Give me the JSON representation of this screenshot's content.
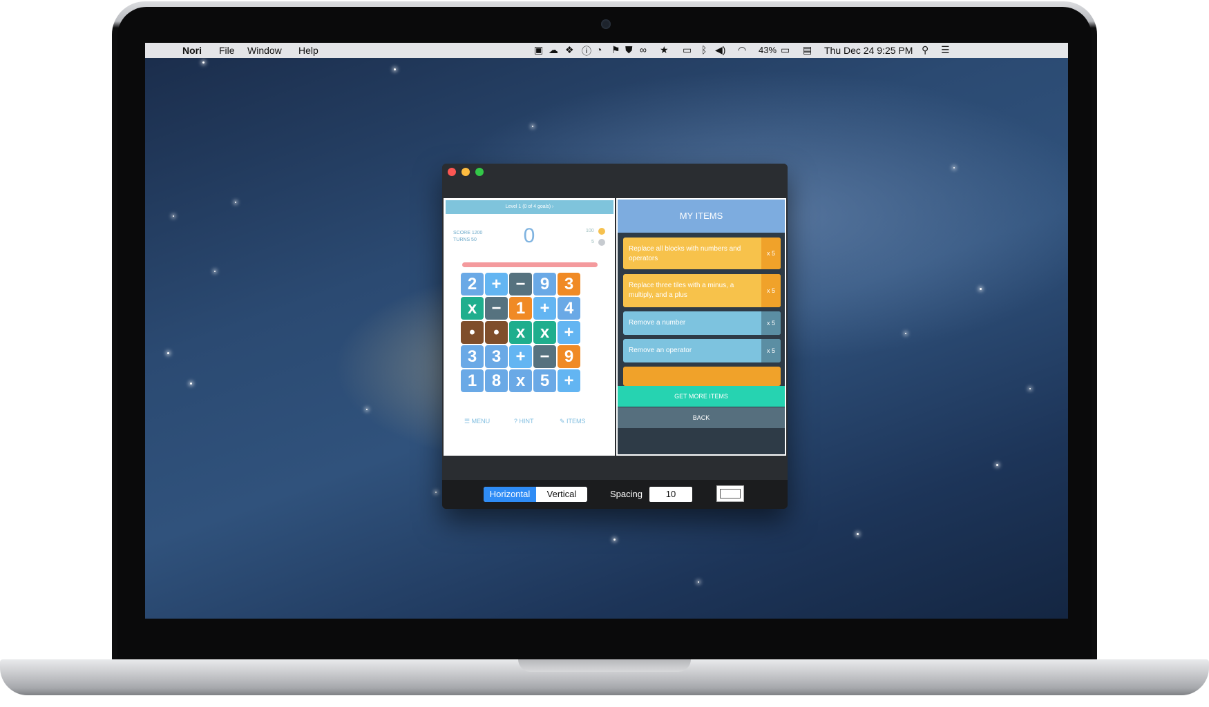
{
  "menubar": {
    "app_name": "Nori",
    "menus": [
      "File",
      "Window",
      "Help"
    ],
    "battery": "43%",
    "clock": "Thu Dec 24  9:25 PM"
  },
  "game": {
    "level_label": "Level 1 (0 of 4 goals) ›",
    "score_label": "SCORE 1200",
    "turns_label": "TURNS 50",
    "score_value": "0",
    "coins_a": "100",
    "coins_b": "5",
    "grid": [
      [
        "2",
        "+",
        "−",
        "9",
        "3"
      ],
      [
        "x",
        "−",
        "1",
        "+",
        "4"
      ],
      [
        "•",
        "•",
        "x",
        "x",
        "+"
      ],
      [
        "3",
        "3",
        "+",
        "−",
        "9"
      ],
      [
        "1",
        "8",
        "x",
        "5",
        "+"
      ]
    ],
    "grid_colors": [
      [
        "blue",
        "sky",
        "dark",
        "blue",
        "orange"
      ],
      [
        "green",
        "dark",
        "orange",
        "sky",
        "blue"
      ],
      [
        "brown",
        "brown",
        "green",
        "green",
        "sky"
      ],
      [
        "blue",
        "blue",
        "sky",
        "dark",
        "orange"
      ],
      [
        "blue",
        "blue",
        "blue",
        "blue",
        "sky"
      ]
    ],
    "menu_button": "MENU",
    "hint_button": "HINT",
    "items_button": "ITEMS"
  },
  "items_panel": {
    "title": "MY ITEMS",
    "items": [
      {
        "label": "Replace all blocks with numbers and operators",
        "count": "x 5",
        "color": "#f7c24b",
        "count_color": "#f0a22a"
      },
      {
        "label": "Replace three tiles with a minus, a multiply, and a plus",
        "count": "x 5",
        "color": "#f7c24b",
        "count_color": "#f0a22a"
      },
      {
        "label": "Remove a number",
        "count": "x 5",
        "color": "#7dc3df",
        "count_color": "#5b8ea3"
      },
      {
        "label": "Remove an operator",
        "count": "x 5",
        "color": "#7dc3df",
        "count_color": "#5b8ea3"
      }
    ],
    "get_more": "GET MORE ITEMS",
    "back": "BACK"
  },
  "toolbar": {
    "horizontal": "Horizontal",
    "vertical": "Vertical",
    "spacing_label": "Spacing",
    "spacing_value": "10"
  }
}
